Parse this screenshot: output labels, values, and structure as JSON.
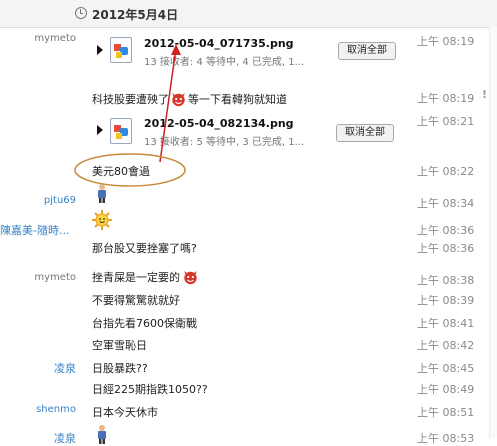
{
  "header": {
    "date": "2012年5月4日",
    "icon": "clock-icon"
  },
  "transfer": {
    "cancel_label": "取消全部"
  },
  "messages": [
    {
      "sender": "mymeto",
      "time": "上午 08:19",
      "file": "2012-05-04_071735.png",
      "status": "13 接收者: 4 等待中, 4 已完成, 1..."
    },
    {
      "text_a": "科技股要遭殃了",
      "text_b": "等一下看韓狗就知道",
      "time": "上午 08:19"
    },
    {
      "time": "上午 08:21",
      "file": "2012-05-04_082134.png",
      "status": "13 接收者: 5 等待中, 3 已完成, 1..."
    },
    {
      "text": "美元80會過",
      "time": "上午 08:22"
    },
    {
      "sender": "pjtu69",
      "time": "上午 08:34"
    },
    {
      "sender": "陳嘉美-隨時...",
      "time": "上午 08:36"
    },
    {
      "text": "那台股又要挫塞了嗎?",
      "time": "上午 08:36"
    },
    {
      "sender": "mymeto",
      "text": "挫青屎是一定要的",
      "time": "上午 08:38"
    },
    {
      "text": "不要得驚驚就就好",
      "time": "上午 08:39"
    },
    {
      "text": "台指先看7600保衛戰",
      "time": "上午 08:41"
    },
    {
      "text": "空軍雪恥日",
      "time": "上午 08:42"
    },
    {
      "sender": "凌泉",
      "text": "日股暴跌??",
      "time": "上午 08:45"
    },
    {
      "text": "日經225期指跌1050??",
      "time": "上午 08:49"
    },
    {
      "sender": "shenmo",
      "text": "日本今天休市",
      "time": "上午 08:51"
    },
    {
      "sender": "凌泉",
      "time": "上午 08:53"
    }
  ],
  "colors": {
    "annotation_red": "#cc2222",
    "annotation_ellipse": "#c98a3a",
    "sender_blue": "#3a84c6"
  }
}
